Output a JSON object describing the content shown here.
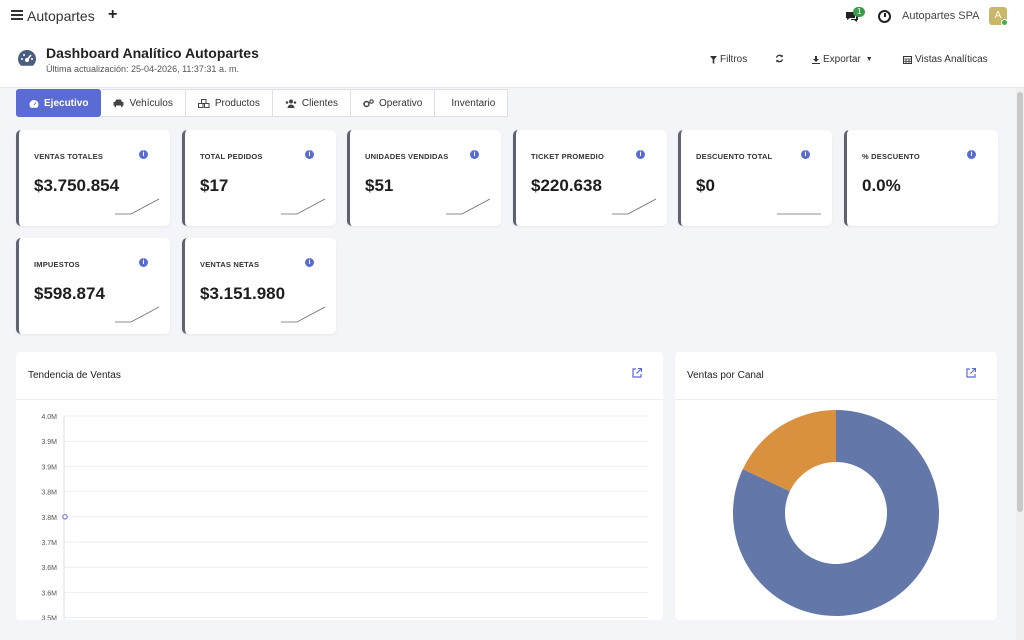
{
  "topbar": {
    "brand": "Autopartes",
    "chat_badge": "1",
    "company": "Autopartes SPA",
    "avatar_letter": "A"
  },
  "header": {
    "title": "Dashboard Analítico Autopartes",
    "subtitle": "Última actualización: 25-04-2026, 11:37:31 a. m.",
    "filters_label": "Filtros",
    "export_label": "Exportar",
    "views_label": "Vistas Analíticas"
  },
  "tabs": [
    {
      "label": "Ejecutivo",
      "icon": "gauge-icon",
      "active": true
    },
    {
      "label": "Vehículos",
      "icon": "car-icon"
    },
    {
      "label": "Productos",
      "icon": "cubes-icon"
    },
    {
      "label": "Clientes",
      "icon": "users-icon"
    },
    {
      "label": "Operativo",
      "icon": "cogs-icon"
    },
    {
      "label": "Inventario",
      "icon": ""
    }
  ],
  "kpis": [
    {
      "label": "VENTAS TOTALES",
      "value": "$3.750.854"
    },
    {
      "label": "TOTAL PEDIDOS",
      "value": "$17"
    },
    {
      "label": "UNIDADES VENDIDAS",
      "value": "$51"
    },
    {
      "label": "TICKET PROMEDIO",
      "value": "$220.638"
    },
    {
      "label": "DESCUENTO TOTAL",
      "value": "$0"
    },
    {
      "label": "% DESCUENTO",
      "value": "0.0%"
    },
    {
      "label": "IMPUESTOS",
      "value": "$598.874"
    },
    {
      "label": "VENTAS NETAS",
      "value": "$3.151.980"
    }
  ],
  "panels": {
    "trend_title": "Tendencia de Ventas",
    "channel_title": "Ventas por Canal"
  },
  "colors": {
    "accent": "#5b6bd4",
    "donut_main": "#6378a8",
    "donut_second": "#d9913f"
  },
  "chart_data": [
    {
      "type": "line",
      "title": "Tendencia de Ventas",
      "ytick_labels": [
        "4.0M",
        "3.9M",
        "3.9M",
        "3.8M",
        "3.8M",
        "3.7M",
        "3.6M",
        "3.6M",
        "3.5M"
      ],
      "ylim": [
        3.5,
        4.0
      ],
      "series": [
        {
          "values": [
            3.75
          ]
        }
      ],
      "grid": true
    },
    {
      "type": "pie",
      "title": "Ventas por Canal",
      "donut": true,
      "slices": [
        {
          "value": 82,
          "color": "#6378a8"
        },
        {
          "value": 18,
          "color": "#d9913f"
        }
      ]
    }
  ]
}
